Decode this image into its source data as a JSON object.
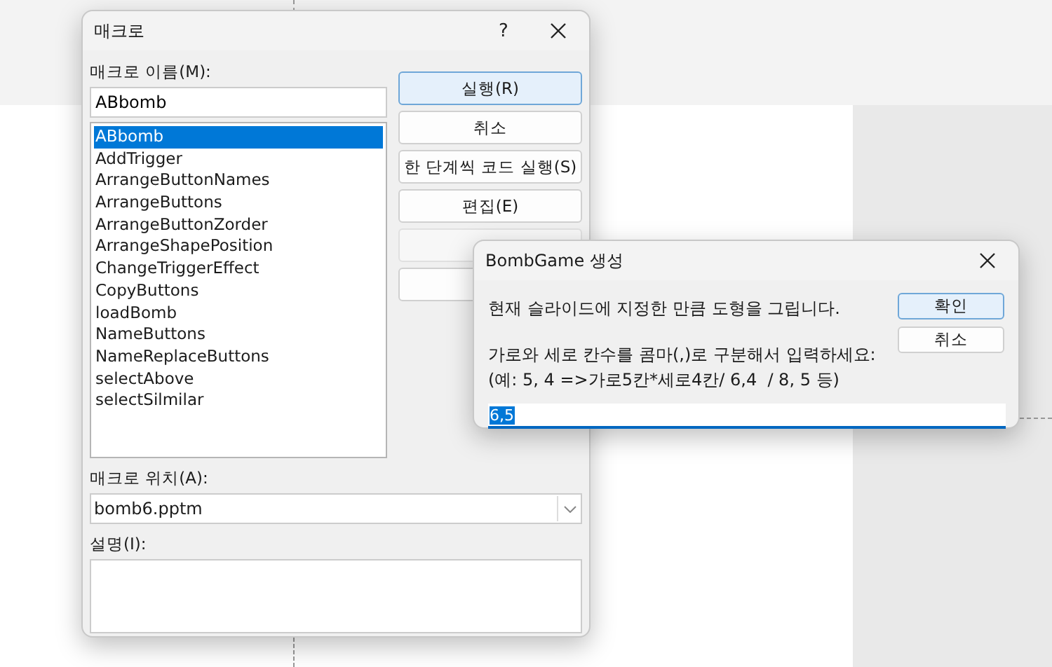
{
  "macro_dialog": {
    "title": "매크로",
    "help": "?",
    "name_label": "매크로 이름(M):",
    "name_value": "ABbomb",
    "macros": [
      {
        "name": "ABbomb",
        "selected": true
      },
      {
        "name": "AddTrigger",
        "selected": false
      },
      {
        "name": "ArrangeButtonNames",
        "selected": false
      },
      {
        "name": "ArrangeButtons",
        "selected": false
      },
      {
        "name": "ArrangeButtonZorder",
        "selected": false
      },
      {
        "name": "ArrangeShapePosition",
        "selected": false
      },
      {
        "name": "ChangeTriggerEffect",
        "selected": false
      },
      {
        "name": "CopyButtons",
        "selected": false
      },
      {
        "name": "loadBomb",
        "selected": false
      },
      {
        "name": "NameButtons",
        "selected": false
      },
      {
        "name": "NameReplaceButtons",
        "selected": false
      },
      {
        "name": "selectAbove",
        "selected": false
      },
      {
        "name": "selectSilmilar",
        "selected": false
      }
    ],
    "buttons": [
      {
        "label": "실행(R)",
        "disabled": false,
        "default": true
      },
      {
        "label": "취소",
        "disabled": false,
        "default": false
      },
      {
        "label": "한 단계씩 코드 실행(S)",
        "disabled": false,
        "default": false
      },
      {
        "label": "편집(E)",
        "disabled": false,
        "default": false
      },
      {
        "disabled": true,
        "default": false
      },
      {
        "disabled": false,
        "default": false
      }
    ],
    "location_label": "매크로 위치(A):",
    "location_value": "bomb6.pptm",
    "description_label": "설명(I):"
  },
  "input_dialog": {
    "title": "BombGame 생성",
    "message": "현재 슬라이드에 지정한 만큼 도형을 그립니다.",
    "prompt_lines": [
      "가로와 세로 칸수를 콤마(,)로 구분해서 입력하세요:",
      "(예: 5, 4 =>가로5칸*세로4칸/ 6,4  / 8, 5 등)"
    ],
    "ok": "확인",
    "cancel": "취소",
    "value": "6,5",
    "value_selected": true
  }
}
